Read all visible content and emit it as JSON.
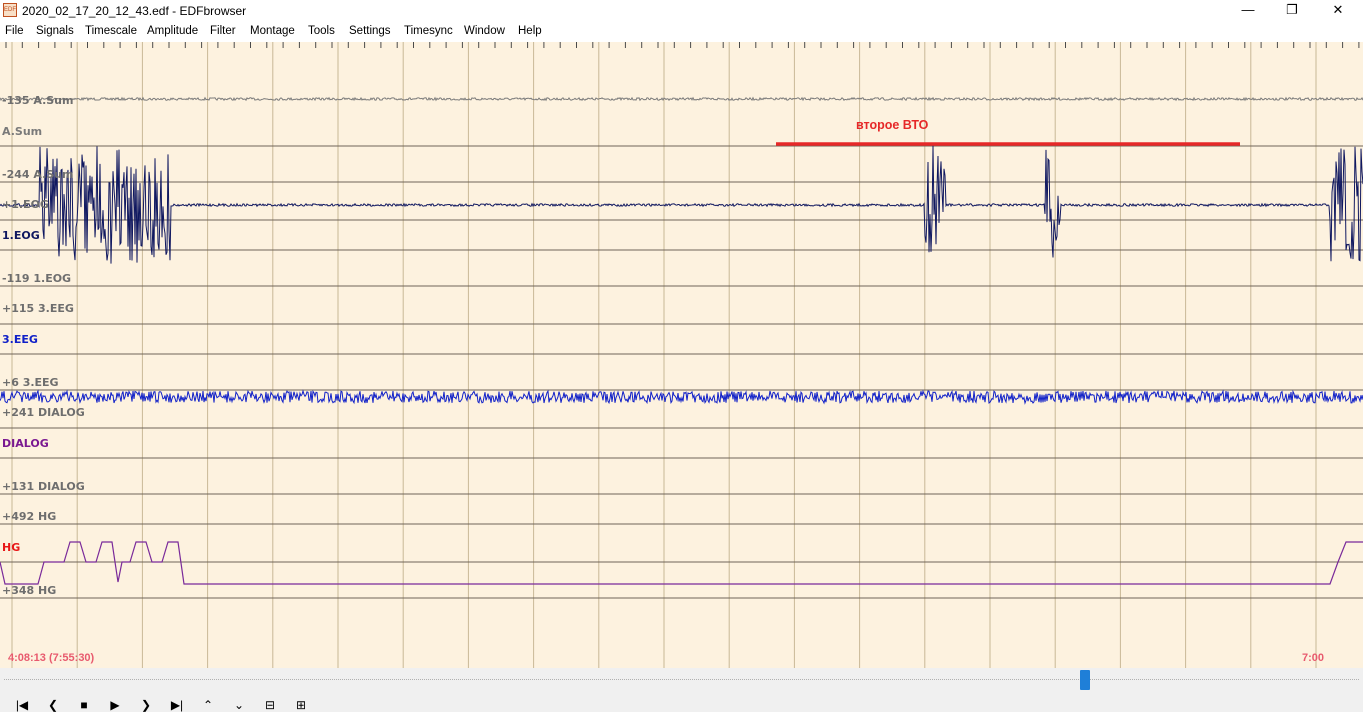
{
  "window": {
    "title": "2020_02_17_20_12_43.edf - EDFbrowser",
    "app_icon": "EDF",
    "minimize_icon": "—",
    "maximize_icon": "❐",
    "close_icon": "✕"
  },
  "menu": [
    "File",
    "Signals",
    "Timescale",
    "Amplitude",
    "Filter",
    "Montage",
    "Tools",
    "Settings",
    "Timesync",
    "Window",
    "Help"
  ],
  "signals": [
    {
      "name": "A.Sum",
      "upper": "-135 A.Sum",
      "lower": "-244 A.Sum",
      "color": "#7a7a7a"
    },
    {
      "name": "1.EOG",
      "upper": "+1.EOG",
      "lower": "-119 1.EOG",
      "color": "#101860"
    },
    {
      "name": "3.EEG",
      "upper": "+115 3.EEG",
      "lower": "+6 3.EEG",
      "color": "#1020c8"
    },
    {
      "name": "DIALOG",
      "upper": "+241 DIALOG",
      "lower": "+131 DIALOG",
      "color": "#7a1890"
    },
    {
      "name": "HG",
      "upper": "+492 HG",
      "lower": "+348 HG",
      "color": "#e81818"
    }
  ],
  "annotation": {
    "text": "второе ВТО",
    "color": "#e62828"
  },
  "time": {
    "start": "4:08:13 (7:55:30)",
    "end": "7:00"
  },
  "colors": {
    "background": "#fdf2df",
    "grid": "#c8b896",
    "baseline": "#6e6458",
    "hg_trace": "#7a2a9a",
    "scroll_thumb": "#1f7fd8"
  },
  "scrollbar": {
    "position": 0.8
  },
  "toolbar": {
    "first": "|◀",
    "prev": "❮",
    "stop": "■",
    "play": "▶",
    "next": "❯",
    "last": "▶|",
    "up": "⌃",
    "down": "⌄",
    "zoom_out": "⊟",
    "zoom_in": "⊞"
  }
}
